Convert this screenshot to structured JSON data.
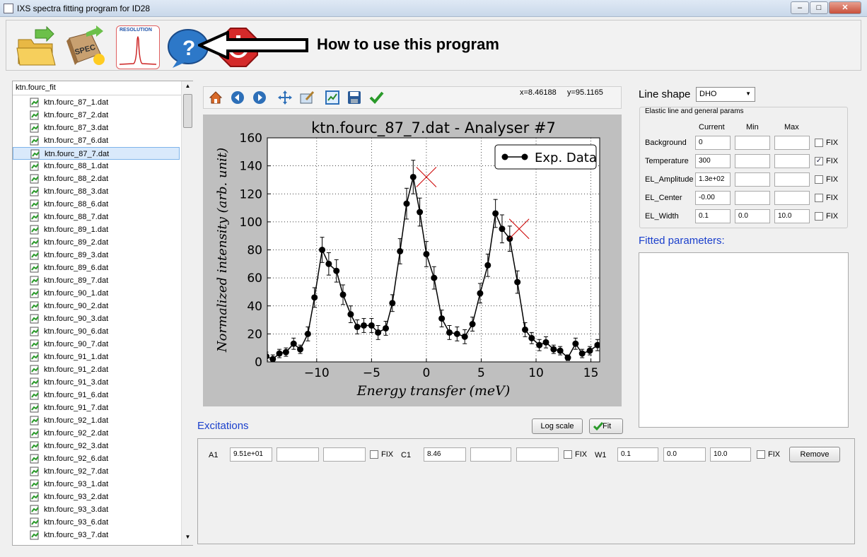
{
  "window": {
    "title": "IXS spectra fitting program for ID28",
    "min": "–",
    "max": "□",
    "close": "✕"
  },
  "toolbar": {
    "icons": [
      "open-folder-icon",
      "spec-file-icon",
      "resolution-icon",
      "help-icon",
      "power-icon"
    ],
    "resolution_text": "RESOLUTION",
    "spec_text": "SPEC",
    "help_hint": "How to use this program"
  },
  "file_panel": {
    "header": "ktn.fourc_fit",
    "files": [
      "ktn.fourc_87_1.dat",
      "ktn.fourc_87_2.dat",
      "ktn.fourc_87_3.dat",
      "ktn.fourc_87_6.dat",
      "ktn.fourc_87_7.dat",
      "ktn.fourc_88_1.dat",
      "ktn.fourc_88_2.dat",
      "ktn.fourc_88_3.dat",
      "ktn.fourc_88_6.dat",
      "ktn.fourc_88_7.dat",
      "ktn.fourc_89_1.dat",
      "ktn.fourc_89_2.dat",
      "ktn.fourc_89_3.dat",
      "ktn.fourc_89_6.dat",
      "ktn.fourc_89_7.dat",
      "ktn.fourc_90_1.dat",
      "ktn.fourc_90_2.dat",
      "ktn.fourc_90_3.dat",
      "ktn.fourc_90_6.dat",
      "ktn.fourc_90_7.dat",
      "ktn.fourc_91_1.dat",
      "ktn.fourc_91_2.dat",
      "ktn.fourc_91_3.dat",
      "ktn.fourc_91_6.dat",
      "ktn.fourc_91_7.dat",
      "ktn.fourc_92_1.dat",
      "ktn.fourc_92_2.dat",
      "ktn.fourc_92_3.dat",
      "ktn.fourc_92_6.dat",
      "ktn.fourc_92_7.dat",
      "ktn.fourc_93_1.dat",
      "ktn.fourc_93_2.dat",
      "ktn.fourc_93_3.dat",
      "ktn.fourc_93_6.dat",
      "ktn.fourc_93_7.dat"
    ],
    "selected": "ktn.fourc_87_7.dat"
  },
  "plot_toolbar": {
    "icons": [
      "home-icon",
      "back-arrow-icon",
      "forward-arrow-icon",
      "pan-icon",
      "configure-icon",
      "zoom-fit-icon",
      "save-icon",
      "checkmark-icon"
    ],
    "coords": "x=8.46188     y=95.1165"
  },
  "chart_data": {
    "type": "scatter",
    "title": "ktn.fourc_87_7.dat - Analyser #7",
    "xlabel": "Energy transfer (meV)",
    "ylabel": "Normalized intensity (arb. unit)",
    "xlim": [
      -14.5,
      15.8
    ],
    "ylim": [
      0,
      160
    ],
    "xticks": [
      -10,
      -5,
      0,
      5,
      10,
      15
    ],
    "xticklabels": [
      "−10",
      "−5",
      "0",
      "5",
      "10",
      "15"
    ],
    "yticks": [
      0,
      20,
      40,
      60,
      80,
      100,
      120,
      140,
      160
    ],
    "yticklabels": [
      "0",
      "20",
      "40",
      "60",
      "80",
      "100",
      "120",
      "140",
      "160"
    ],
    "grid": true,
    "legend_position": "top-right",
    "series": [
      {
        "name": "Exp. Data",
        "x": [
          -14.6,
          -14,
          -13.4,
          -12.8,
          -12.1,
          -11.5,
          -10.8,
          -10.2,
          -9.5,
          -8.9,
          -8.2,
          -7.6,
          -6.9,
          -6.3,
          -5.7,
          -5.0,
          -4.4,
          -3.7,
          -3.1,
          -2.4,
          -1.8,
          -1.2,
          -0.6,
          0,
          0.7,
          1.4,
          2.1,
          2.8,
          3.5,
          4.2,
          4.9,
          5.6,
          6.3,
          6.9,
          7.6,
          8.3,
          9.0,
          9.6,
          10.3,
          10.9,
          11.6,
          12.2,
          12.9,
          13.6,
          14.2,
          14.9,
          15.6
        ],
        "y": [
          4,
          2,
          6,
          7,
          13,
          9,
          20,
          46,
          80,
          70,
          65,
          48,
          34,
          25,
          26,
          26,
          21,
          24,
          42,
          79,
          113,
          132,
          107,
          77,
          60,
          31,
          21,
          20,
          18,
          27,
          49,
          69,
          106,
          95,
          88,
          57,
          23,
          17,
          12,
          14,
          9,
          8,
          3,
          13,
          6,
          8,
          12
        ],
        "yerr": [
          3,
          3,
          3,
          3,
          4,
          3,
          5,
          7,
          9,
          8,
          8,
          7,
          6,
          5,
          5,
          5,
          5,
          5,
          6,
          9,
          11,
          12,
          10,
          9,
          8,
          6,
          5,
          5,
          5,
          5,
          7,
          8,
          10,
          10,
          9,
          8,
          5,
          4,
          4,
          4,
          3,
          3,
          2,
          4,
          3,
          3,
          4
        ],
        "color": "#000000"
      }
    ],
    "fit_markers": [
      {
        "x": 0,
        "y": 132
      },
      {
        "x": 8.46,
        "y": 95
      }
    ],
    "fit_marker_color": "#cc0000"
  },
  "params": {
    "lineshape_label": "Line shape",
    "lineshape_value": "DHO",
    "group_title": "Elastic line and general params",
    "col_current": "Current",
    "col_min": "Min",
    "col_max": "Max",
    "fix": "FIX",
    "rows": [
      {
        "name": "Background",
        "current": "0",
        "min": "",
        "max": "",
        "fix": false
      },
      {
        "name": "Temperature",
        "current": "300",
        "min": "",
        "max": "",
        "fix": true
      },
      {
        "name": "EL_Amplitude",
        "current": "1.3e+02",
        "min": "",
        "max": "",
        "fix": false
      },
      {
        "name": "EL_Center",
        "current": "-0.00",
        "min": "",
        "max": "",
        "fix": false
      },
      {
        "name": "EL_Width",
        "current": "0.1",
        "min": "0.0",
        "max": "10.0",
        "fix": false
      }
    ],
    "fitted_label": "Fitted parameters:",
    "fitted_text": ""
  },
  "excitations": {
    "label": "Excitations",
    "log_scale": "Log scale",
    "fit": "Fit",
    "a1_label": "A1",
    "a1_value": "9.51e+01",
    "a1_min": "",
    "a1_max": "",
    "c1_label": "C1",
    "c1_value": "8.46",
    "c1_min": "",
    "c1_max": "",
    "w1_label": "W1",
    "w1_value": "0.1",
    "w1_min": "0.0",
    "w1_max": "10.0",
    "fix": "FIX",
    "remove": "Remove"
  }
}
